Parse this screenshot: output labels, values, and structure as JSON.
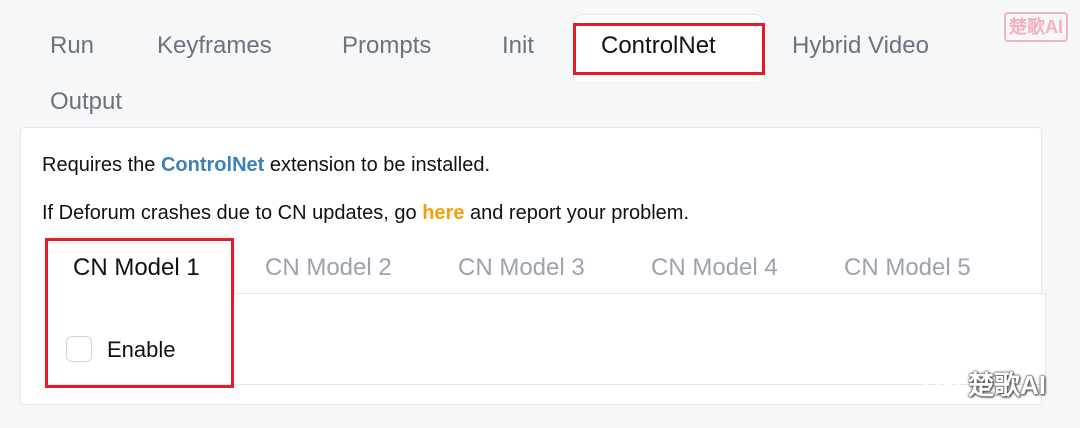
{
  "top_tabs": [
    {
      "label": "Run"
    },
    {
      "label": "Keyframes"
    },
    {
      "label": "Prompts"
    },
    {
      "label": "Init"
    },
    {
      "label": "ControlNet",
      "active": true
    },
    {
      "label": "Hybrid Video"
    },
    {
      "label": "Output"
    }
  ],
  "info": {
    "line1_prefix": "Requires the ",
    "line1_link": "ControlNet",
    "line1_suffix": " extension to be installed.",
    "line2_prefix": "If Deforum crashes due to CN updates, go ",
    "line2_link": "here",
    "line2_suffix": " and report your problem."
  },
  "cn_tabs": [
    {
      "label": "CN Model 1",
      "active": true
    },
    {
      "label": "CN Model 2"
    },
    {
      "label": "CN Model 3"
    },
    {
      "label": "CN Model 4"
    },
    {
      "label": "CN Model 5"
    }
  ],
  "enable": {
    "label": "Enable",
    "checked": false
  },
  "watermark": {
    "top_text": "楚歌AI",
    "bottom_text": "楚歌AI"
  },
  "colors": {
    "highlight": "#e11d2a",
    "link_blue": "#3b82b8",
    "link_orange": "#f59e0b"
  }
}
